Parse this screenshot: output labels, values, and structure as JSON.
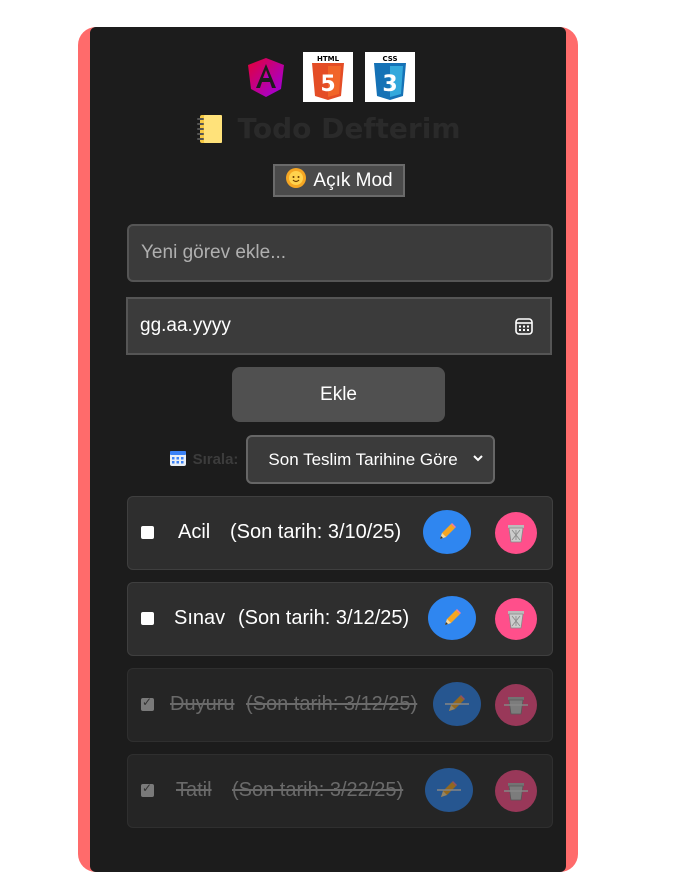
{
  "header": {
    "logos": [
      "angular-logo",
      "html5-logo",
      "css3-logo"
    ],
    "title": "Todo Defterim",
    "mode_button_label": "Açık Mod"
  },
  "form": {
    "task_placeholder": "Yeni görev ekle...",
    "date_placeholder": "gg.aa.yyyy",
    "add_button_label": "Ekle"
  },
  "sort": {
    "label": "Sırala:",
    "selected": "Son Teslim Tarihine Göre"
  },
  "todos": [
    {
      "text": "Acil",
      "due": "(Son tarih: 3/10/25)",
      "done": false
    },
    {
      "text": "Sınav",
      "due": "(Son tarih: 3/12/25)",
      "done": false
    },
    {
      "text": "Duyuru",
      "due": "(Son tarih: 3/12/25)",
      "done": true
    },
    {
      "text": "Tatil",
      "due": "(Son tarih: 3/22/25)",
      "done": true
    }
  ],
  "colors": {
    "frame": "#ff6b6b",
    "card": "#1c1c1c",
    "edit_button": "#2f86f0",
    "delete_button": "#ff4f8b"
  }
}
